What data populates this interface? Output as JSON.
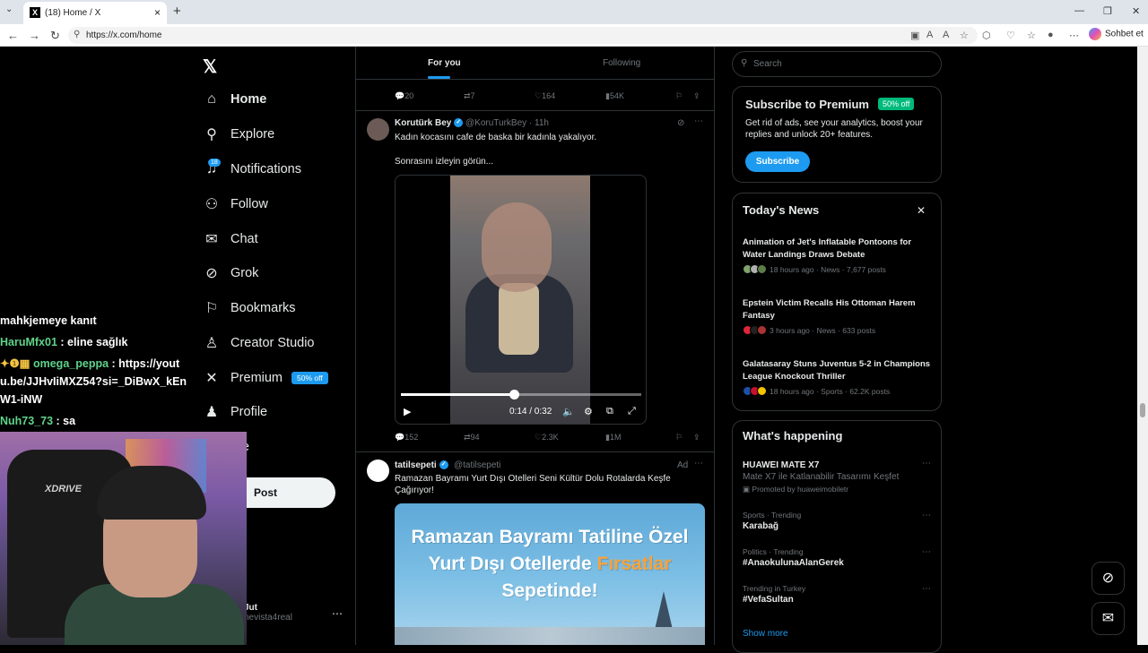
{
  "browser": {
    "tab_title": "(18) Home / X",
    "url": "https://x.com/home",
    "copilot_label": "Sohbet et"
  },
  "nav": {
    "items": [
      {
        "label": "Home",
        "icon": "home-icon"
      },
      {
        "label": "Explore",
        "icon": "search-icon"
      },
      {
        "label": "Notifications",
        "icon": "bell-icon"
      },
      {
        "label": "Follow",
        "icon": "add-person-icon"
      },
      {
        "label": "Chat",
        "icon": "mail-icon"
      },
      {
        "label": "Grok",
        "icon": "grok-icon"
      },
      {
        "label": "Bookmarks",
        "icon": "bookmark-icon"
      },
      {
        "label": "Creator Studio",
        "icon": "creator-icon"
      },
      {
        "label": "Premium",
        "icon": "x-icon"
      },
      {
        "label": "Profile",
        "icon": "person-icon"
      },
      {
        "label": "ore",
        "icon": "more-icon"
      }
    ],
    "notifications_badge": "18",
    "premium_pill": "50% off",
    "post_label": "Post",
    "user_name": "Jut",
    "user_handle": "nevista4real"
  },
  "chat_overlay": {
    "lines": [
      {
        "user": "",
        "text": "mahkjemeye kanıt"
      },
      {
        "user": "HaruMfx01",
        "text": ": eline sağlık"
      },
      {
        "user": "omega_peppa",
        "text": ": https://youtu.be/JJHvIiMXZ54?si=_DiBwX_kEnW1-iNW",
        "prefix": "✦❶▦"
      },
      {
        "user": "Nuh73_73",
        "text": ": sa"
      }
    ],
    "webcam_chair_text": "XDRIVE"
  },
  "feed": {
    "tabs": {
      "foryou": "For you",
      "following": "Following"
    },
    "top_actions": {
      "replies": "20",
      "reposts": "7",
      "likes": "164",
      "views": "54K"
    },
    "tweet1": {
      "name": "Korutürk Bey",
      "handle": "@KoruTurkBey · 11h",
      "text1": "Kadın kocasını cafe de baska bir kadınla yakalıyor.",
      "text2": "Sonrasını izleyin görün...",
      "video_time": "0:14 / 0:32",
      "video_progress": 0.47,
      "actions": {
        "replies": "152",
        "reposts": "94",
        "likes": "2.3K",
        "views": "1M"
      }
    },
    "tweet2": {
      "name": "tatilsepeti",
      "handle": "@tatilsepeti",
      "ad_label": "Ad",
      "text": "Ramazan Bayramı Yurt Dışı Otelleri Seni Kültür Dolu Rotalarda Keşfe Çağırıyor!",
      "image_line1": "Ramazan Bayramı Tatiline Özel",
      "image_line2a": "Yurt Dışı Otellerde",
      "image_line2b": "Fırsatlar",
      "image_line3": "Sepetinde!"
    }
  },
  "sidebar": {
    "search_placeholder": "Search",
    "premium": {
      "title": "Subscribe to Premium",
      "pill": "50% off",
      "desc": "Get rid of ads, see your analytics, boost your replies and unlock 20+ features.",
      "button": "Subscribe"
    },
    "news": {
      "title": "Today's News",
      "items": [
        {
          "title": "Animation of Jet's Inflatable Pontoons for Water Landings Draws Debate",
          "meta": "18 hours ago · News · 7,677 posts"
        },
        {
          "title": "Epstein Victim Recalls His Ottoman Harem Fantasy",
          "meta": "3 hours ago · News · 633 posts"
        },
        {
          "title": "Galatasaray Stuns Juventus 5-2 in Champions League Knockout Thriller",
          "meta": "18 hours ago · Sports · 62.2K posts"
        }
      ]
    },
    "happening": {
      "title": "What's happening",
      "trends": [
        {
          "category": "",
          "name": "HUAWEI MATE X7",
          "sub": "Mate X7 ile Katlanabilir Tasarımı Keşfet",
          "promo": "Promoted by huaweimobiletr"
        },
        {
          "category": "Sports · Trending",
          "name": "Karabağ"
        },
        {
          "category": "Politics · Trending",
          "name": "#AnaokulunaAlanGerek"
        },
        {
          "category": "Trending in Turkey",
          "name": "#VefaSultan"
        }
      ],
      "show_more": "Show more"
    }
  }
}
